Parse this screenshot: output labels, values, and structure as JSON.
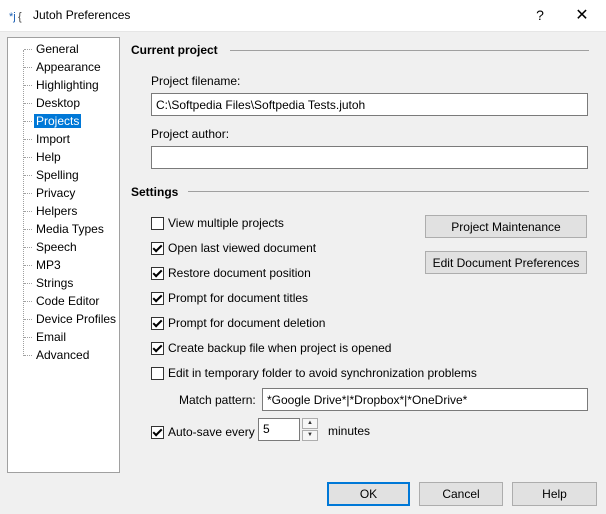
{
  "window": {
    "title": "Jutoh Preferences",
    "help_glyph": "?",
    "close_glyph": "✕"
  },
  "nav": {
    "items": [
      {
        "label": "General",
        "selected": false
      },
      {
        "label": "Appearance",
        "selected": false
      },
      {
        "label": "Highlighting",
        "selected": false
      },
      {
        "label": "Desktop",
        "selected": false
      },
      {
        "label": "Projects",
        "selected": true
      },
      {
        "label": "Import",
        "selected": false
      },
      {
        "label": "Help",
        "selected": false
      },
      {
        "label": "Spelling",
        "selected": false
      },
      {
        "label": "Privacy",
        "selected": false
      },
      {
        "label": "Helpers",
        "selected": false
      },
      {
        "label": "Media Types",
        "selected": false
      },
      {
        "label": "Speech",
        "selected": false
      },
      {
        "label": "MP3",
        "selected": false
      },
      {
        "label": "Strings",
        "selected": false
      },
      {
        "label": "Code Editor",
        "selected": false
      },
      {
        "label": "Device Profiles",
        "selected": false
      },
      {
        "label": "Email",
        "selected": false
      },
      {
        "label": "Advanced",
        "selected": false
      }
    ]
  },
  "current_project": {
    "section_title": "Current project",
    "filename_label": "Project filename:",
    "filename_value": "C:\\Softpedia Files\\Softpedia Tests.jutoh",
    "author_label": "Project author:",
    "author_value": ""
  },
  "settings": {
    "section_title": "Settings",
    "checkboxes": [
      {
        "label": "View multiple projects",
        "checked": false
      },
      {
        "label": "Open last viewed document",
        "checked": true
      },
      {
        "label": "Restore document position",
        "checked": true
      },
      {
        "label": "Prompt for document titles",
        "checked": true
      },
      {
        "label": "Prompt for document deletion",
        "checked": true
      },
      {
        "label": "Create backup file when project is opened",
        "checked": true
      },
      {
        "label": "Edit in temporary folder to avoid synchronization problems",
        "checked": false
      }
    ],
    "project_maintenance_label": "Project Maintenance",
    "edit_doc_prefs_label": "Edit Document Preferences",
    "match_pattern_label": "Match pattern:",
    "match_pattern_value": "*Google Drive*|*Dropbox*|*OneDrive*",
    "autosave_label": "Auto-save every",
    "autosave_checked": true,
    "autosave_value": "5",
    "autosave_unit": "minutes"
  },
  "footer": {
    "ok_label": "OK",
    "cancel_label": "Cancel",
    "help_label": "Help"
  }
}
